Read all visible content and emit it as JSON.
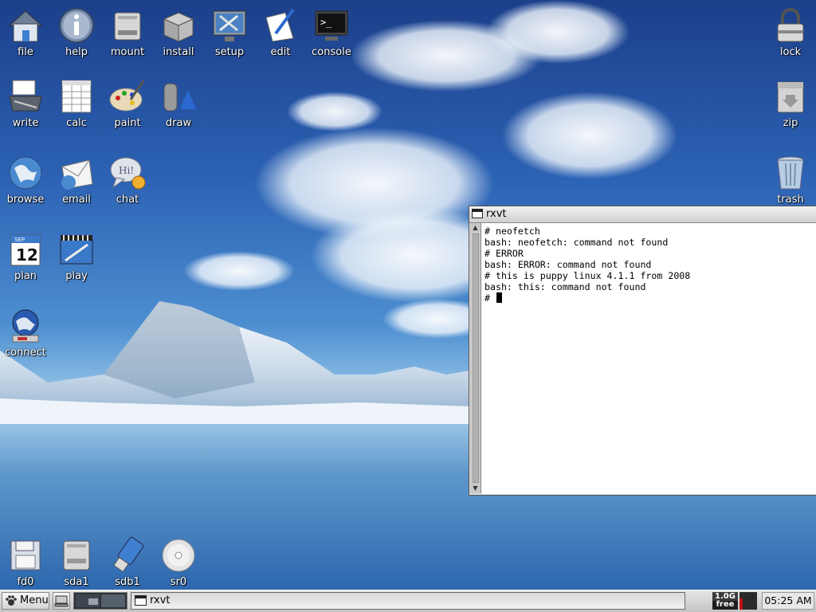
{
  "desktop": {
    "icons_left": [
      {
        "label": "file",
        "icon": "home-folder-icon"
      },
      {
        "label": "help",
        "icon": "info-icon"
      },
      {
        "label": "mount",
        "icon": "drive-icon"
      },
      {
        "label": "install",
        "icon": "package-box-icon"
      },
      {
        "label": "setup",
        "icon": "tools-monitor-icon"
      },
      {
        "label": "edit",
        "icon": "pen-paper-icon"
      },
      {
        "label": "console",
        "icon": "terminal-icon"
      },
      {
        "label": "write",
        "icon": "typewriter-icon"
      },
      {
        "label": "calc",
        "icon": "spreadsheet-icon"
      },
      {
        "label": "paint",
        "icon": "palette-icon"
      },
      {
        "label": "draw",
        "icon": "draw-shapes-icon"
      },
      {
        "label": "browse",
        "icon": "globe-icon"
      },
      {
        "label": "email",
        "icon": "envelope-globe-icon"
      },
      {
        "label": "chat",
        "icon": "chat-bubble-icon"
      },
      {
        "label": "plan",
        "icon": "calendar-icon"
      },
      {
        "label": "play",
        "icon": "media-film-icon"
      },
      {
        "label": "connect",
        "icon": "network-globe-icon"
      }
    ],
    "icons_right": [
      {
        "label": "lock",
        "icon": "padlock-icon"
      },
      {
        "label": "zip",
        "icon": "archive-icon"
      },
      {
        "label": "trash",
        "icon": "trash-icon"
      }
    ],
    "drives": [
      {
        "label": "fd0",
        "icon": "floppy-icon"
      },
      {
        "label": "sda1",
        "icon": "harddisk-icon"
      },
      {
        "label": "sdb1",
        "icon": "usb-stick-icon"
      },
      {
        "label": "sr0",
        "icon": "optical-disc-icon"
      }
    ],
    "calendar_day": "12",
    "calendar_month": "SEP"
  },
  "rxvt": {
    "title": "rxvt",
    "lines": [
      "# neofetch",
      "bash: neofetch: command not found",
      "# ERROR",
      "bash: ERROR: command not found",
      "# this is puppy linux 4.1.1 from 2008",
      "bash: this: command not found"
    ],
    "prompt": "# "
  },
  "taskbar": {
    "menu_label": "Menu",
    "task_label": "rxvt",
    "free_mem_amount": "1.0G",
    "free_mem_label": "free",
    "clock": "05:25 AM"
  }
}
